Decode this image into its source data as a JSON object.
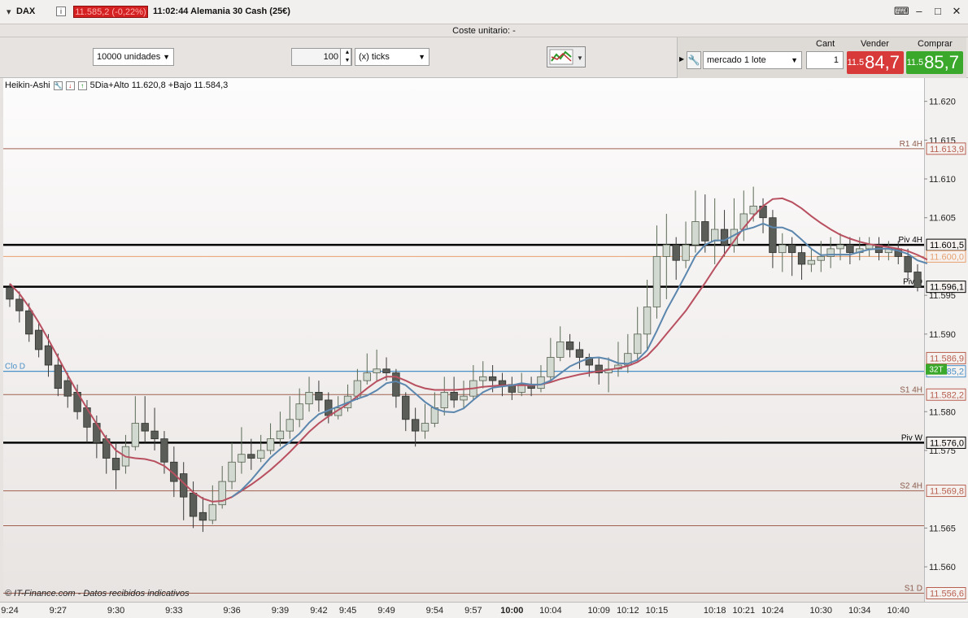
{
  "window": {
    "symbol": "DAX",
    "price_badge": "11.585,2 (-0,22%)",
    "title": "11:02:44 Alemania 30 Cash (25€)"
  },
  "cost_bar": "Coste unitario:  -",
  "toolbar": {
    "units": "10000 unidades",
    "ticks_value": "100",
    "ticks_unit": "(x) ticks",
    "order_type": "mercado 1 lote",
    "cant_label": "Cant",
    "cant_value": "1",
    "sell_label": "Vender",
    "buy_label": "Comprar",
    "sell_prefix": "11.5",
    "sell_big": "84,7",
    "buy_prefix": "11.5",
    "buy_big": "85,7"
  },
  "legend": {
    "name": "Heikin-Ashi",
    "text": "5Dia+Alto 11.620,8 +Bajo 11.584,3"
  },
  "copyright": "© IT-Finance.com - Datos recibidos indicativos",
  "colors": {
    "bull_fill": "#d2d9d0",
    "bear_fill": "#5a5d58",
    "sma_slow": "#b85060",
    "sma_fast": "#5b86ad",
    "pivot_line": "#000000",
    "level_line": "#a06050",
    "close_line": "#4a90c8"
  },
  "chart_data": {
    "type": "candlestick",
    "ylim": [
      11555.5,
      11623
    ],
    "y_ticks": [
      "11.620",
      "11.615",
      "11.610",
      "11.605",
      "11.595",
      "11.590",
      "11.580",
      "11.575",
      "11.565",
      "11.560"
    ],
    "y_tick_values": [
      11620,
      11615,
      11610,
      11605,
      11595,
      11590,
      11580,
      11575,
      11565,
      11560
    ],
    "x_labels": [
      "9:24",
      "9:27",
      "9:30",
      "9:33",
      "9:36",
      "9:39",
      "9:42",
      "9:45",
      "9:49",
      "9:54",
      "9:57",
      "10:00",
      "10:04",
      "10:09",
      "10:12",
      "10:15",
      "10:18",
      "10:21",
      "10:24",
      "10:30",
      "10:34",
      "10:40"
    ],
    "x_label_index": [
      0,
      5,
      11,
      17,
      23,
      28,
      32,
      35,
      39,
      44,
      48,
      52,
      56,
      61,
      64,
      67,
      73,
      76,
      79,
      84,
      88,
      92
    ],
    "levels": [
      {
        "name": "R1 4H",
        "value": 11613.9,
        "label": "11.613,9",
        "kind": "thin"
      },
      {
        "name": "Piv 4H",
        "value": 11601.5,
        "label": "11.601,5",
        "kind": "pivot"
      },
      {
        "name": "",
        "value": 11600.0,
        "label": "11.600,0",
        "kind": "orange"
      },
      {
        "name": "Piv D",
        "value": 11596.1,
        "label": "11.596,1",
        "kind": "pivot"
      },
      {
        "name": "Clo D",
        "value": 11585.2,
        "label": "11.585,2",
        "kind": "close"
      },
      {
        "name": "",
        "value": 11586.9,
        "label": "11.586,9",
        "kind": "none"
      },
      {
        "name": "S1 4H",
        "value": 11582.2,
        "label": "11.582,2",
        "kind": "thin"
      },
      {
        "name": "Piv W",
        "value": 11576.0,
        "label": "11.576,0",
        "kind": "pivot"
      },
      {
        "name": "S2 4H",
        "value": 11569.8,
        "label": "11.569,8",
        "kind": "thin"
      },
      {
        "name": "",
        "value": 11565.3,
        "label": "",
        "kind": "thin"
      },
      {
        "name": "S1 D",
        "value": 11556.6,
        "label": "11.556,6",
        "kind": "thin"
      }
    ],
    "timeframe_badge": "32T",
    "candles": [
      [
        11596.0,
        11594.5,
        11596.5,
        11593.5
      ],
      [
        11594.5,
        11593.0,
        11595.5,
        11591.5
      ],
      [
        11593.0,
        11590.0,
        11594.0,
        11589.0
      ],
      [
        11590.5,
        11588.0,
        11591.5,
        11587.0
      ],
      [
        11588.5,
        11586.0,
        11590.0,
        11584.5
      ],
      [
        11586.0,
        11583.0,
        11587.5,
        11582.0
      ],
      [
        11584.0,
        11582.0,
        11585.0,
        11580.5
      ],
      [
        11582.5,
        11580.0,
        11583.5,
        11579.0
      ],
      [
        11580.5,
        11578.0,
        11581.5,
        11576.0
      ],
      [
        11578.5,
        11576.0,
        11579.5,
        11574.0
      ],
      [
        11576.5,
        11574.0,
        11577.0,
        11572.0
      ],
      [
        11574.0,
        11572.5,
        11576.0,
        11570.0
      ],
      [
        11573.0,
        11575.5,
        11577.0,
        11572.0
      ],
      [
        11575.5,
        11578.5,
        11582.0,
        11575.0
      ],
      [
        11578.5,
        11577.5,
        11582.0,
        11576.0
      ],
      [
        11577.5,
        11576.5,
        11580.5,
        11575.0
      ],
      [
        11576.5,
        11573.5,
        11577.5,
        11572.0
      ],
      [
        11573.5,
        11571.0,
        11575.5,
        11569.0
      ],
      [
        11572.0,
        11569.0,
        11573.5,
        11566.0
      ],
      [
        11569.5,
        11566.5,
        11571.0,
        11565.0
      ],
      [
        11567.0,
        11566.0,
        11569.0,
        11564.5
      ],
      [
        11566.0,
        11568.0,
        11570.5,
        11565.5
      ],
      [
        11568.0,
        11571.0,
        11573.0,
        11567.5
      ],
      [
        11571.0,
        11573.5,
        11576.0,
        11570.0
      ],
      [
        11573.5,
        11574.5,
        11578.0,
        11572.0
      ],
      [
        11574.5,
        11574.0,
        11576.5,
        11572.5
      ],
      [
        11574.0,
        11575.0,
        11577.0,
        11573.5
      ],
      [
        11575.0,
        11576.5,
        11578.5,
        11574.5
      ],
      [
        11576.5,
        11577.5,
        11580.0,
        11575.5
      ],
      [
        11577.5,
        11579.0,
        11582.0,
        11576.5
      ],
      [
        11579.0,
        11581.0,
        11583.0,
        11578.0
      ],
      [
        11581.0,
        11582.5,
        11584.5,
        11580.0
      ],
      [
        11582.5,
        11581.5,
        11584.0,
        11580.0
      ],
      [
        11581.5,
        11579.5,
        11582.5,
        11578.5
      ],
      [
        11579.5,
        11580.5,
        11582.0,
        11579.0
      ],
      [
        11580.5,
        11582.0,
        11583.5,
        11580.0
      ],
      [
        11582.0,
        11584.0,
        11585.5,
        11581.5
      ],
      [
        11584.0,
        11585.0,
        11587.5,
        11583.5
      ],
      [
        11585.0,
        11585.5,
        11588.0,
        11584.0
      ],
      [
        11585.5,
        11585.0,
        11587.0,
        11584.0
      ],
      [
        11585.0,
        11582.0,
        11585.5,
        11580.5
      ],
      [
        11582.0,
        11579.0,
        11582.5,
        11577.5
      ],
      [
        11579.0,
        11577.5,
        11580.5,
        11575.5
      ],
      [
        11577.5,
        11578.5,
        11581.0,
        11576.5
      ],
      [
        11578.5,
        11580.5,
        11582.5,
        11578.0
      ],
      [
        11580.5,
        11582.5,
        11584.5,
        11579.5
      ],
      [
        11582.5,
        11581.5,
        11584.5,
        11580.5
      ],
      [
        11581.5,
        11582.0,
        11584.0,
        11580.5
      ],
      [
        11582.0,
        11584.0,
        11586.0,
        11581.5
      ],
      [
        11584.0,
        11584.5,
        11586.5,
        11583.0
      ],
      [
        11584.5,
        11584.0,
        11586.0,
        11582.5
      ],
      [
        11584.0,
        11583.5,
        11585.0,
        11582.0
      ],
      [
        11583.5,
        11582.5,
        11584.5,
        11581.5
      ],
      [
        11582.5,
        11583.5,
        11585.0,
        11582.0
      ],
      [
        11583.5,
        11583.0,
        11584.5,
        11582.0
      ],
      [
        11583.0,
        11584.5,
        11586.0,
        11582.5
      ],
      [
        11584.5,
        11587.0,
        11589.5,
        11584.0
      ],
      [
        11587.0,
        11589.0,
        11591.0,
        11586.5
      ],
      [
        11589.0,
        11588.0,
        11590.0,
        11587.0
      ],
      [
        11588.0,
        11587.0,
        11589.0,
        11585.5
      ],
      [
        11587.0,
        11586.0,
        11587.5,
        11584.5
      ],
      [
        11586.0,
        11585.0,
        11587.0,
        11583.5
      ],
      [
        11585.0,
        11585.5,
        11587.0,
        11582.5
      ],
      [
        11585.5,
        11586.0,
        11589.0,
        11584.5
      ],
      [
        11586.0,
        11587.5,
        11590.0,
        11585.0
      ],
      [
        11587.5,
        11590.0,
        11593.5,
        11586.5
      ],
      [
        11590.0,
        11593.5,
        11597.0,
        11588.0
      ],
      [
        11593.5,
        11600.0,
        11604.0,
        11592.0
      ],
      [
        11600.0,
        11601.5,
        11605.5,
        11594.5
      ],
      [
        11601.5,
        11599.5,
        11602.5,
        11597.0
      ],
      [
        11599.5,
        11601.5,
        11604.5,
        11598.5
      ],
      [
        11601.5,
        11604.5,
        11608.5,
        11600.5
      ],
      [
        11604.5,
        11602.0,
        11608.0,
        11600.5
      ],
      [
        11602.0,
        11603.5,
        11607.5,
        11599.0
      ],
      [
        11603.5,
        11601.5,
        11606.0,
        11600.0
      ],
      [
        11601.5,
        11603.5,
        11607.5,
        11600.5
      ],
      [
        11603.5,
        11605.5,
        11608.5,
        11602.0
      ],
      [
        11605.5,
        11606.5,
        11609.0,
        11604.5
      ],
      [
        11606.5,
        11605.0,
        11607.5,
        11603.0
      ],
      [
        11605.0,
        11600.5,
        11606.0,
        11598.5
      ],
      [
        11600.5,
        11601.5,
        11603.0,
        11598.0
      ],
      [
        11601.5,
        11600.5,
        11602.5,
        11597.5
      ],
      [
        11600.5,
        11599.0,
        11601.5,
        11597.0
      ],
      [
        11599.0,
        11599.5,
        11601.0,
        11598.0
      ],
      [
        11599.5,
        11600.0,
        11602.0,
        11598.0
      ],
      [
        11600.0,
        11601.0,
        11602.5,
        11598.5
      ],
      [
        11601.0,
        11601.5,
        11603.0,
        11599.5
      ],
      [
        11601.5,
        11600.5,
        11602.5,
        11599.0
      ],
      [
        11600.5,
        11601.0,
        11602.5,
        11599.5
      ],
      [
        11601.0,
        11601.5,
        11602.5,
        11600.0
      ],
      [
        11601.5,
        11600.5,
        11602.5,
        11599.5
      ],
      [
        11600.5,
        11601.0,
        11602.0,
        11599.5
      ],
      [
        11601.0,
        11600.0,
        11602.0,
        11599.0
      ],
      [
        11600.0,
        11598.0,
        11601.0,
        11597.0
      ],
      [
        11598.0,
        11596.0,
        11599.0,
        11595.5
      ]
    ],
    "sma_slow": [
      11596.5,
      11595.2,
      11593.5,
      11591.5,
      11589.3,
      11587.0,
      11584.7,
      11582.5,
      11580.4,
      11578.4,
      11576.5,
      11575.0,
      11574.2,
      11574.0,
      11573.9,
      11573.6,
      11573.0,
      11572.0,
      11570.8,
      11569.6,
      11568.8,
      11568.4,
      11568.5,
      11569.0,
      11569.8,
      11570.6,
      11571.5,
      11572.5,
      11573.6,
      11574.8,
      11576.1,
      11577.4,
      11578.5,
      11579.4,
      11580.2,
      11581.0,
      11582.0,
      11583.0,
      11583.9,
      11584.5,
      11584.5,
      11584.0,
      11583.4,
      11583.0,
      11582.8,
      11582.8,
      11582.8,
      11582.9,
      11583.0,
      11583.2,
      11583.3,
      11583.4,
      11583.4,
      11583.4,
      11583.4,
      11583.5,
      11583.8,
      11584.2,
      11584.5,
      11584.8,
      11585.0,
      11585.2,
      11585.4,
      11585.6,
      11585.9,
      11586.4,
      11587.2,
      11588.5,
      11590.0,
      11591.5,
      11593.0,
      11594.8,
      11596.6,
      11598.5,
      11600.3,
      11602.0,
      11603.7,
      11605.2,
      11606.5,
      11607.4,
      11607.5,
      11607.0,
      11606.2,
      11605.2,
      11604.3,
      11603.5,
      11602.8,
      11602.3,
      11601.9,
      11601.6,
      11601.4,
      11601.2,
      11601.0,
      11600.7,
      11600.2,
      11599.6
    ]
  }
}
